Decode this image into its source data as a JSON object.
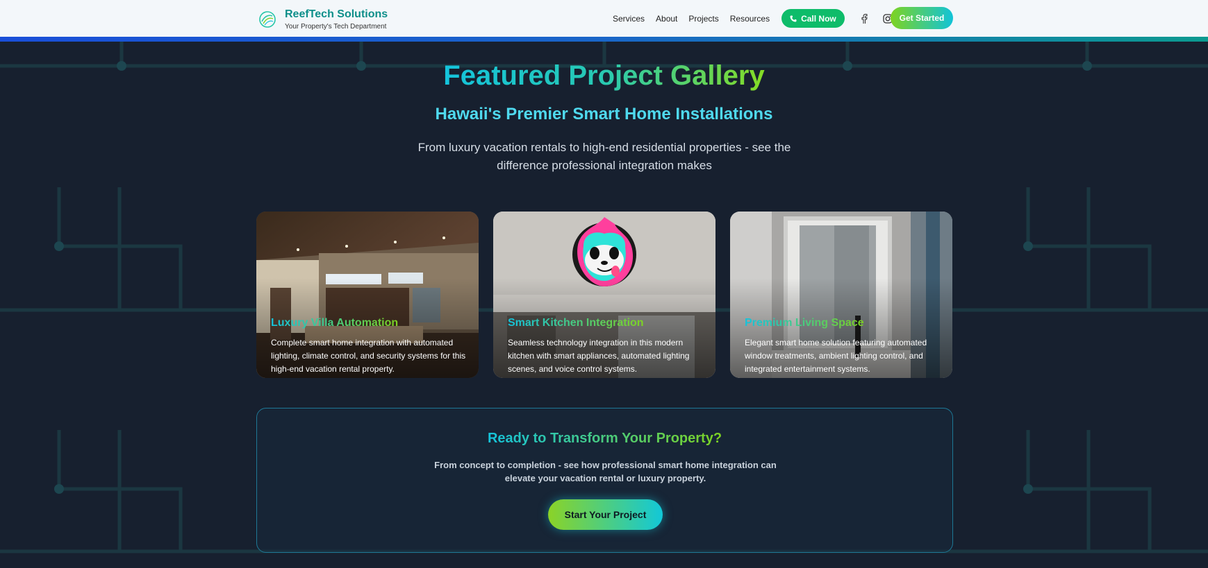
{
  "header": {
    "brand_title": "ReefTech Solutions",
    "brand_sub": "Your Property's Tech Department",
    "nav": [
      "Services",
      "About",
      "Projects",
      "Resources"
    ],
    "call_label": "Call Now",
    "get_started": "Get Started"
  },
  "hero": {
    "title": "Featured Project Gallery",
    "subtitle": "Hawaii's Premier Smart Home Installations",
    "description": "From luxury vacation rentals to high-end residential properties - see the difference professional integration makes"
  },
  "cards": [
    {
      "title": "Luxury Villa Automation",
      "description": "Complete smart home integration with automated lighting, climate control, and security systems for this high-end vacation rental property."
    },
    {
      "title": "Smart Kitchen Integration",
      "description": "Seamless technology integration in this modern kitchen with smart appliances, automated lighting scenes, and voice control systems."
    },
    {
      "title": "Premium Living Space",
      "description": "Elegant smart home solution featuring automated window treatments, ambient lighting control, and integrated entertainment systems."
    }
  ],
  "cta": {
    "title": "Ready to Transform Your Property?",
    "description": "From concept to completion - see how professional smart home integration can elevate your vacation rental or luxury property.",
    "button": "Start Your Project"
  },
  "colors": {
    "accent_teal": "#14c3dc",
    "accent_green": "#7ed321",
    "brand": "#0e8f8a",
    "call_green": "#0ebc6a",
    "background": "#17202f"
  },
  "icons": {
    "logo": "wave-logo-icon",
    "phone": "phone-icon",
    "facebook": "facebook-icon",
    "instagram": "instagram-icon"
  }
}
